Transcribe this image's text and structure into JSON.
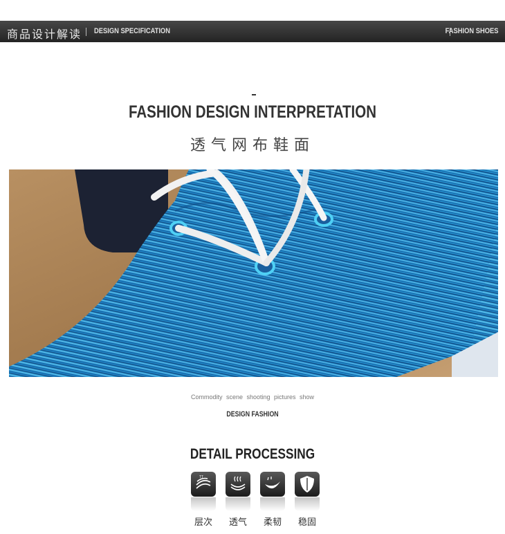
{
  "header": {
    "cn_title": "商品设计解读",
    "en_title": "DESIGN SPECIFICATION",
    "right_label": "FASHION SHOES"
  },
  "section": {
    "title": "FASHION DESIGN INTERPRETATION",
    "subtitle_cn": "透气网布鞋面"
  },
  "photo": {
    "description_icon": "blue-knit-shoe-upper-photo"
  },
  "caption": {
    "line1": "Commodity scene shooting pictures show",
    "line2": "DESIGN FASHION"
  },
  "detail": {
    "title": "DETAIL PROCESSING",
    "features": [
      {
        "label": "层次",
        "icon": "layers-icon"
      },
      {
        "label": "透气",
        "icon": "breathable-icon"
      },
      {
        "label": "柔韧",
        "icon": "flexible-icon"
      },
      {
        "label": "稳固",
        "icon": "shield-icon"
      }
    ]
  },
  "colors": {
    "header_bg": "#2e2e2e",
    "knit_blue": "#2a9bd8",
    "lace": "#f2f2f2"
  }
}
